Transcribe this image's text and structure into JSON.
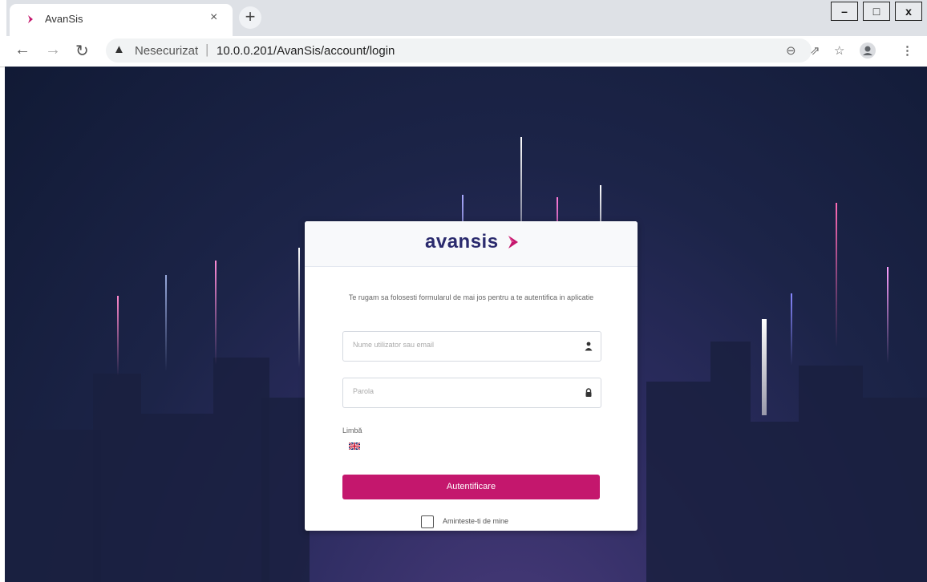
{
  "browser": {
    "tab_title": "AvanSis",
    "tab_close": "×",
    "new_tab": "+",
    "security_label": "Nesecurizat",
    "separator": "|",
    "url": "10.0.0.201/AvanSis/account/login",
    "window_buttons": [
      "–",
      "□",
      "x"
    ]
  },
  "login": {
    "logo_text": "avansis",
    "intro": "Te rugam sa folosesti formularul de mai jos pentru a te autentifica in aplicatie",
    "username_placeholder": "Nume utilizator sau email",
    "password_placeholder": "Parola",
    "language_label": "Limbă",
    "submit_label": "Autentificare",
    "remember_label": "Aminteste-ti de mine"
  },
  "colors": {
    "accent": "#c4176d",
    "brand": "#2b2b6e"
  }
}
